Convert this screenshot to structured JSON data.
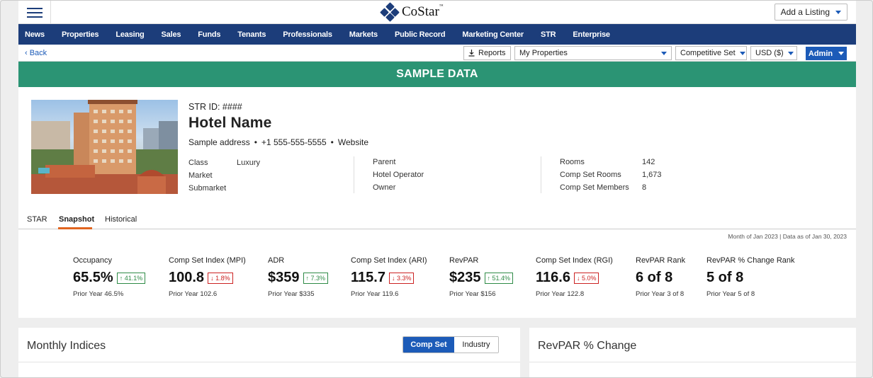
{
  "topbar": {
    "brand": "CoStar",
    "brand_tm": "™",
    "add_listing": "Add a Listing"
  },
  "nav": [
    "News",
    "Properties",
    "Leasing",
    "Sales",
    "Funds",
    "Tenants",
    "Professionals",
    "Markets",
    "Public Record",
    "Marketing Center",
    "STR",
    "Enterprise"
  ],
  "subbar": {
    "back": "‹ Back",
    "reports": "Reports",
    "my_properties": "My Properties",
    "competitive_set": "Competitive Set",
    "currency": "USD ($)",
    "admin": "Admin"
  },
  "banner": "SAMPLE DATA",
  "hotel": {
    "str_id": "STR ID: ####",
    "name": "Hotel Name",
    "address": "Sample address",
    "phone": "+1 555-555-5555",
    "website": "Website",
    "dot": "•",
    "class_label": "Class",
    "class_value": "Luxury",
    "market_label": "Market",
    "submarket_label": "Submarket",
    "parent_label": "Parent",
    "operator_label": "Hotel Operator",
    "owner_label": "Owner",
    "rooms_label": "Rooms",
    "rooms_value": "142",
    "comp_rooms_label": "Comp Set Rooms",
    "comp_rooms_value": "1,673",
    "comp_members_label": "Comp Set Members",
    "comp_members_value": "8"
  },
  "tabs": [
    "STAR",
    "Snapshot",
    "Historical"
  ],
  "kpi": {
    "as_of": "Month of Jan 2023 | Data as of Jan 30, 2023",
    "metrics": [
      {
        "label": "Occupancy",
        "value": "65.5%",
        "change": "↑ 41.1%",
        "prior": "Prior Year  46.5%"
      },
      {
        "label": "Comp Set Index (MPI)",
        "value": "100.8",
        "change": "↓ 1.8%",
        "prior": "Prior Year  102.6"
      },
      {
        "label": "ADR",
        "value": "$359",
        "change": "↑ 7.3%",
        "prior": "Prior Year  $335"
      },
      {
        "label": "Comp Set Index (ARI)",
        "value": "115.7",
        "change": "↓ 3.3%",
        "prior": "Prior Year  119.6"
      },
      {
        "label": "RevPAR",
        "value": "$235",
        "change": "↑ 51.4%",
        "prior": "Prior Year  $156"
      },
      {
        "label": "Comp Set Index (RGI)",
        "value": "116.6",
        "change": "↓ 5.0%",
        "prior": "Prior Year  122.8"
      },
      {
        "label": "RevPAR Rank",
        "value": "6 of 8",
        "change": "",
        "prior": "Prior Year  3 of 8"
      },
      {
        "label": "RevPAR % Change Rank",
        "value": "5 of 8",
        "change": "",
        "prior": "Prior Year  5 of 8"
      }
    ]
  },
  "cards": {
    "monthly_title": "Monthly Indices",
    "toggle_on": "Comp Set",
    "toggle_off": "Industry",
    "revpar_title": "RevPAR % Change"
  },
  "colors": {
    "nav_blue": "#1c3d7a",
    "accent_blue": "#1c5bb8",
    "banner_green": "#2b9474",
    "tab_orange": "#e0641f",
    "up_green": "#2e8b46",
    "down_red": "#cc2222"
  }
}
